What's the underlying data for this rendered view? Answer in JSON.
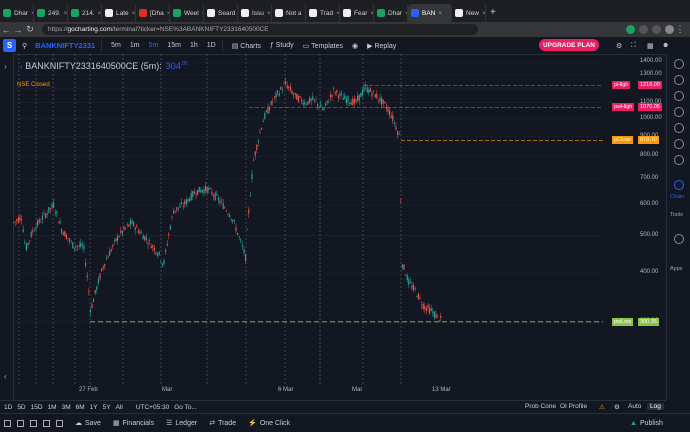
{
  "browser": {
    "tabs": [
      {
        "label": "Dhar",
        "color": "#1aa260"
      },
      {
        "label": "249.",
        "color": "#1aa260"
      },
      {
        "label": "214.",
        "color": "#1aa260"
      },
      {
        "label": "Late",
        "color": "#eeeeee"
      },
      {
        "label": "[Dha",
        "color": "#d93025"
      },
      {
        "label": "Weel",
        "color": "#1aa260"
      },
      {
        "label": "Seard",
        "color": "#eeeeee"
      },
      {
        "label": "Issu",
        "color": "#eeeeee"
      },
      {
        "label": "Not a",
        "color": "#eeeeee"
      },
      {
        "label": "Trad",
        "color": "#eeeeee"
      },
      {
        "label": "Fear",
        "color": "#eeeeee"
      },
      {
        "label": "Dhar",
        "color": "#1aa260"
      },
      {
        "label": "BAN",
        "color": "#2962ff",
        "active": true
      },
      {
        "label": "New",
        "color": "#eeeeee"
      }
    ],
    "url_host": "gocharting.com",
    "url_prefix": "https://",
    "url_path": "/terminal?ticker=NSE%3ABANKNIFTY2331640500CE"
  },
  "toolbar": {
    "logo": "S",
    "symbol": "BANKNIFTY2331",
    "intervals": [
      "5m",
      "1m",
      "5m",
      "15m",
      "1h",
      "1D"
    ],
    "charts_label": "Charts",
    "study_label": "Study",
    "templates_label": "Templates",
    "replay_label": "Replay",
    "upgrade_label": "UPGRADE PLAN"
  },
  "legend": {
    "title": "BANKNIFTY2331640500CE (5m):",
    "value": "304",
    "value_sup": ".00",
    "status": "NSE Closed"
  },
  "price_scale": {
    "ticks": [
      "1400.00",
      "1300.00",
      "1200.00",
      "1100.00",
      "1000.00",
      "900.00",
      "800.00",
      "700.00",
      "600.00",
      "500.00",
      "400.00",
      "300.00"
    ],
    "tags": [
      {
        "label": "pHigh",
        "value": "1219.00",
        "color": "#e91e63"
      },
      {
        "label": "pwHigh",
        "value": "1070.05",
        "color": "#e91e63"
      },
      {
        "label": "pClose",
        "value": "879.70",
        "color": "#ff9800"
      },
      {
        "label": "pwLow",
        "value": "300.35",
        "color": "#8bc34a"
      }
    ]
  },
  "time_axis": [
    "27 Feb",
    "Mar",
    "6 Mar",
    "Mar",
    "13 Mar"
  ],
  "chart_data": {
    "type": "candlestick",
    "ylim": [
      300,
      1400
    ],
    "levels": {
      "pHigh": 1219.0,
      "pwHigh": 1070.05,
      "pClose": 879.7,
      "pwLow": 300.35
    },
    "last": 304.0
  },
  "right_sidebar": {
    "chain": "Chain",
    "tools": "Tools",
    "apps": "Apps"
  },
  "range_bar": {
    "ranges": [
      "1D",
      "5D",
      "15D",
      "1M",
      "3M",
      "6M",
      "1Y",
      "5Y",
      "All"
    ],
    "timezone": "UTC+05:30",
    "goto": "Go To...",
    "prob_cone": "Prob Cone",
    "oi_profile": "OI Profile",
    "auto": "Auto",
    "log": "Log"
  },
  "footer": {
    "save": "Save",
    "financials": "Financials",
    "ledger": "Ledger",
    "trade": "Trade",
    "one_click": "One Click",
    "publish": "Publish"
  }
}
